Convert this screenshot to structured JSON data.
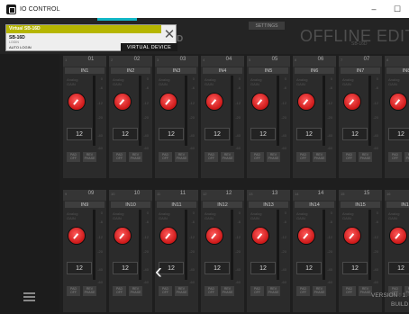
{
  "window": {
    "title": "IO CONTROL",
    "minimize": "–",
    "maximize": "☐"
  },
  "device_popup": {
    "name": "Virtual SB-16D",
    "model": "SB-16D",
    "login_label": "LOGIN",
    "auto_login": "AUTO LOGIN",
    "close_symbol": "✕",
    "badge": "VIRTUAL DEVICE"
  },
  "header": {
    "partial_text": "D",
    "settings_label": "SETTINGS",
    "offline_title": "OFFLINE EDITO",
    "offline_subtitle": "SB-16D"
  },
  "gain": {
    "line1": "Analog",
    "line2": "GAIN"
  },
  "meter_scale": [
    "0",
    "-6",
    "-12",
    "-20",
    "-40",
    "-60"
  ],
  "buttons": {
    "pad": [
      "PAD",
      "OFF"
    ],
    "rev": [
      "REV",
      "PHASE"
    ]
  },
  "channels": [
    {
      "idx": "1",
      "num": "01",
      "label": "IN1",
      "value": "12"
    },
    {
      "idx": "2",
      "num": "02",
      "label": "IN2",
      "value": "12"
    },
    {
      "idx": "3",
      "num": "03",
      "label": "IN3",
      "value": "12"
    },
    {
      "idx": "4",
      "num": "04",
      "label": "IN4",
      "value": "12"
    },
    {
      "idx": "5",
      "num": "05",
      "label": "IN5",
      "value": "12"
    },
    {
      "idx": "6",
      "num": "06",
      "label": "IN6",
      "value": "12"
    },
    {
      "idx": "7",
      "num": "07",
      "label": "IN7",
      "value": "12"
    },
    {
      "idx": "8",
      "num": "08",
      "label": "IN8",
      "value": "12"
    },
    {
      "idx": "9",
      "num": "09",
      "label": "IN9",
      "value": "12"
    },
    {
      "idx": "10",
      "num": "10",
      "label": "IN10",
      "value": "12"
    },
    {
      "idx": "11",
      "num": "11",
      "label": "IN11",
      "value": "12"
    },
    {
      "idx": "12",
      "num": "12",
      "label": "IN12",
      "value": "12"
    },
    {
      "idx": "13",
      "num": "13",
      "label": "IN13",
      "value": "12"
    },
    {
      "idx": "14",
      "num": "14",
      "label": "IN14",
      "value": "12"
    },
    {
      "idx": "15",
      "num": "15",
      "label": "IN15",
      "value": "12"
    },
    {
      "idx": "16",
      "num": "16",
      "label": "IN16",
      "value": "12"
    }
  ],
  "footer": {
    "version": "VERSION : 1.",
    "build": "BUILD",
    "back_symbol": "‹"
  },
  "colors": {
    "accent": "#11b6c6",
    "popup_header": "#b6b600",
    "knob": "#cc1717"
  },
  "icons": [
    "app-icon",
    "close-icon",
    "menu-icon",
    "chevron-left-icon"
  ]
}
